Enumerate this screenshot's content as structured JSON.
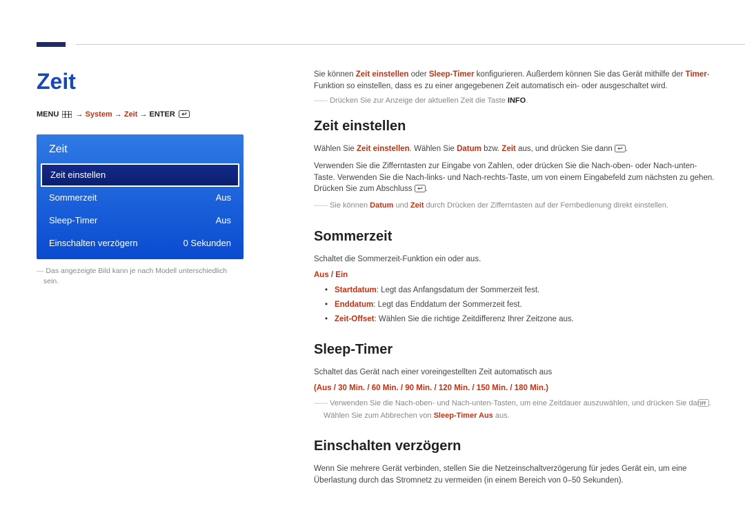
{
  "page": {
    "title": "Zeit"
  },
  "breadcrumb": {
    "menu": "MENU",
    "arrow": "→",
    "system": "System",
    "zeit": "Zeit",
    "enter": "ENTER"
  },
  "osd": {
    "title": "Zeit",
    "rows": [
      {
        "label": "Zeit einstellen",
        "value": ""
      },
      {
        "label": "Sommerzeit",
        "value": "Aus"
      },
      {
        "label": "Sleep-Timer",
        "value": "Aus"
      },
      {
        "label": "Einschalten verzögern",
        "value": "0 Sekunden"
      }
    ],
    "note": "Das angezeigte Bild kann je nach Modell unterschiedlich sein."
  },
  "intro": {
    "p1a": "Sie können ",
    "p1b": "Zeit einstellen",
    "p1c": " oder ",
    "p1d": "Sleep-Timer",
    "p1e": " konfigurieren. Außerdem können Sie das Gerät mithilfe der ",
    "p1f": "Timer",
    "p1g": "-Funktion so einstellen, dass es zu einer angegebenen Zeit automatisch ein- oder ausgeschaltet wird.",
    "note1a": "Drücken Sie zur Anzeige der aktuellen Zeit die Taste ",
    "note1b": "INFO",
    "note1c": "."
  },
  "sec_zeit": {
    "heading": "Zeit einstellen",
    "p1a": "Wählen Sie ",
    "p1b": "Zeit einstellen",
    "p1c": ". Wählen Sie ",
    "p1d": "Datum",
    "p1e": " bzw. ",
    "p1f": "Zeit",
    "p1g": " aus, und drücken Sie dann ",
    "p1h": ".",
    "p2": "Verwenden Sie die Zifferntasten zur Eingabe von Zahlen, oder drücken Sie die Nach-oben- oder Nach-unten-Taste. Verwenden Sie die Nach-links- und Nach-rechts-Taste, um von einem Eingabefeld zum nächsten zu gehen. Drücken Sie zum Abschluss ",
    "p2b": ".",
    "note1a": "Sie können ",
    "note1b": "Datum",
    "note1c": " und ",
    "note1d": "Zeit",
    "note1e": " durch Drücken der Zifferntasten auf der Fernbedienung direkt einstellen."
  },
  "sec_sommer": {
    "heading": "Sommerzeit",
    "p1": "Schaltet die Sommerzeit-Funktion ein oder aus.",
    "options": "Aus / Ein",
    "b1a": "Startdatum",
    "b1b": ": Legt das Anfangsdatum der Sommerzeit fest.",
    "b2a": "Enddatum",
    "b2b": ": Legt das Enddatum der Sommerzeit fest.",
    "b3a": "Zeit-Offset",
    "b3b": ": Wählen Sie die richtige Zeitdifferenz Ihrer Zeitzone aus."
  },
  "sec_sleep": {
    "heading": "Sleep-Timer",
    "p1": "Schaltet das Gerät nach einer voreingestellten Zeit automatisch aus",
    "options": "(Aus / 30 Min. / 60 Min. / 90 Min. / 120 Min. / 150 Min. / 180 Min.)",
    "note1a": "Verwenden Sie die Nach-oben- und Nach-unten-Tasten, um eine Zeitdauer auszuwählen, und drücken Sie dann ",
    "note1b": ". Wählen Sie zum Abbrechen von ",
    "note1c": "Sleep-Timer Aus",
    "note1d": " aus."
  },
  "sec_einsch": {
    "heading": "Einschalten verzögern",
    "p1": "Wenn Sie mehrere Gerät verbinden, stellen Sie die Netzeinschaltverzögerung für jedes Gerät ein, um eine Überlastung durch das Stromnetz zu vermeiden (in einem Bereich von 0–50 Sekunden)."
  }
}
